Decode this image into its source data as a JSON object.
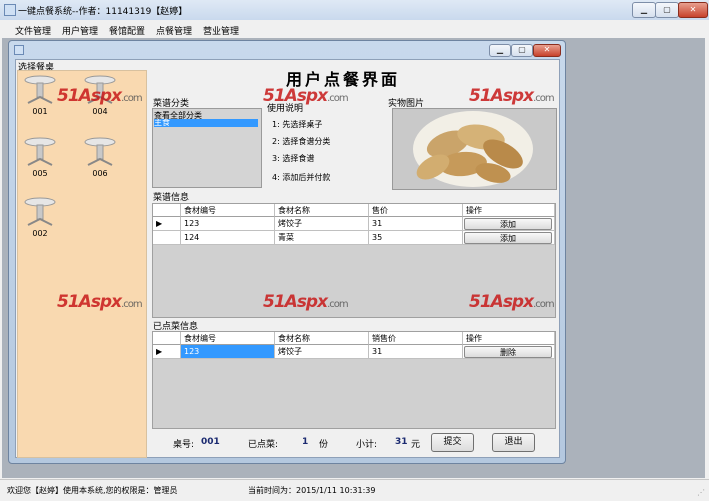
{
  "window": {
    "title": "一键点餐系统--作者：11141319【赵婷】"
  },
  "menubar": [
    "文件管理",
    "用户管理",
    "餐馆配置",
    "点餐管理",
    "营业管理"
  ],
  "panel": {
    "tables_title": "选择餐桌",
    "tables": [
      "001",
      "004",
      "005",
      "006",
      "002"
    ],
    "header": "用户点餐界面",
    "category_title": "菜谱分类",
    "categories": [
      "查看全部分类",
      "主食"
    ],
    "instructions_title": "使用说明",
    "instructions": [
      "1: 先选择桌子",
      "2: 选择食谱分类",
      "3: 选择食谱",
      "4: 添加后并付款"
    ],
    "photo_title": "实物图片",
    "menu_info_title": "菜谱信息",
    "menu_columns": [
      "食材编号",
      "食材名称",
      "售价",
      "操作"
    ],
    "menu_rows": [
      {
        "id": "123",
        "name": "烤饺子",
        "price": "31",
        "action": "添加"
      },
      {
        "id": "124",
        "name": "青菜",
        "price": "35",
        "action": "添加"
      }
    ],
    "ordered_title": "已点菜信息",
    "ordered_columns": [
      "食材编号",
      "食材名称",
      "销售价",
      "操作"
    ],
    "ordered_rows": [
      {
        "id": "123",
        "name": "烤饺子",
        "price": "31",
        "action": "删除"
      }
    ],
    "table_no_label": "桌号:",
    "table_no": "001",
    "ordered_count_label": "已点菜:",
    "ordered_count": "1",
    "count_unit": "份",
    "subtotal_label": "小计:",
    "subtotal": "31",
    "currency": "元",
    "submit": "提交",
    "exit": "退出"
  },
  "watermark": {
    "brand": "51Aspx",
    "domain": ".com"
  },
  "status": {
    "welcome": "欢迎您【赵婷】使用本系统,您的权限是：管理员",
    "time": "当前时间为：2015/1/11 10:31:39"
  },
  "colors": {
    "tables_bg": "#f9d9b0",
    "selection": "#3399ff",
    "watermark": "#c81a1a"
  }
}
